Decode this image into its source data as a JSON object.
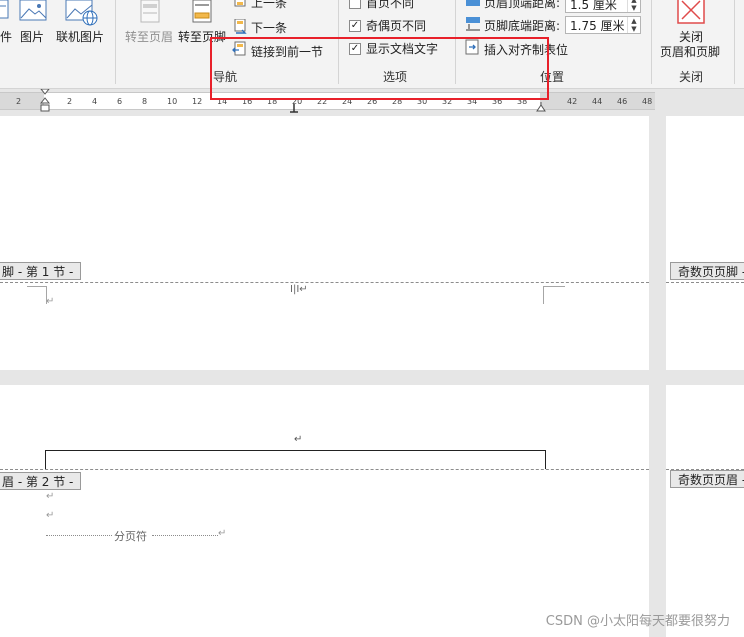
{
  "ribbon": {
    "insert_group": {
      "partial_label": "件",
      "picture_label": "图片",
      "online_picture_label": "联机图片"
    },
    "navigation": {
      "goto_header_label": "转至页眉",
      "goto_footer_label": "转至页脚",
      "prev_label": "上一条",
      "next_label": "下一条",
      "link_prev_label": "链接到前一节",
      "group_label": "导航"
    },
    "options": {
      "first_page_label": "首页不同",
      "odd_even_label": "奇偶页不同",
      "show_doc_text_label": "显示文档文字",
      "first_page_checked": "",
      "odd_even_checked": "✓",
      "show_doc_text_checked": "✓",
      "group_label": "选项"
    },
    "position": {
      "header_top_label": "页眉顶端距离:",
      "header_top_value": "1.5 厘米",
      "footer_bottom_label": "页脚底端距离:",
      "footer_bottom_value": "1.75 厘米",
      "insert_align_tab_label": "插入对齐制表位",
      "group_label": "位置"
    },
    "close": {
      "close_label_line1": "关闭",
      "close_label_line2": "页眉和页脚",
      "group_label": "关闭"
    }
  },
  "ruler": {
    "ticks": [
      "2",
      "2",
      "4",
      "6",
      "8",
      "10",
      "12",
      "14",
      "16",
      "18",
      "20",
      "22",
      "24",
      "26",
      "28",
      "30",
      "32",
      "34",
      "36",
      "38",
      "42",
      "44",
      "46",
      "48"
    ]
  },
  "document": {
    "page1_footer_tab": "脚 - 第 1 节 -",
    "page1_right_footer_tab": "奇数页页脚 -",
    "page2_header_tab": "眉 - 第 2 节 -",
    "page2_right_header_tab": "奇数页页眉 -",
    "para_mark": "↵",
    "cursor_mark": "I|I↵",
    "page_break_label": "分页符"
  },
  "watermark": "CSDN @小太阳每天都要很努力",
  "colors": {
    "highlight_border": "#e8202a",
    "ribbon_bg": "#f3f3f3",
    "page_bg": "#ffffff",
    "workspace_bg": "#e6e6e6"
  }
}
